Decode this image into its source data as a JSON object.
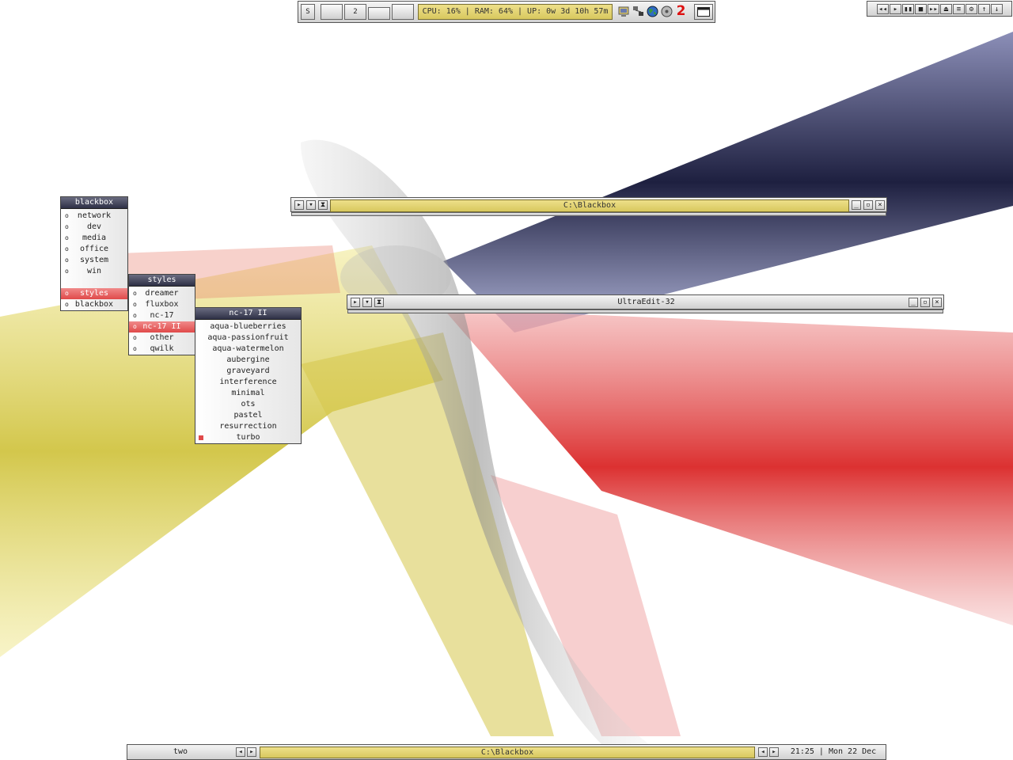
{
  "toolbar": {
    "style_button": "S",
    "workspace_buttons": [
      "",
      "2",
      "",
      ""
    ],
    "status": "CPU: 16% | RAM: 64% | UP: 0w 3d 10h 57m",
    "tray_icons": [
      "system-icon",
      "network-icon",
      "globe-icon",
      "disc-icon",
      "app-2-icon"
    ],
    "tray_icon_label_2": "2"
  },
  "mediabar": {
    "icons": [
      "prev-track-icon",
      "play-icon",
      "pause-icon",
      "stop-icon",
      "next-track-icon",
      "eject-icon",
      "playlist-icon",
      "settings-icon",
      "volume-up-icon",
      "volume-down-icon"
    ]
  },
  "menus": {
    "blackbox": {
      "title": "blackbox",
      "items": [
        "network",
        "dev",
        "media",
        "office",
        "system",
        "win",
        "",
        "styles",
        "blackbox"
      ]
    },
    "styles": {
      "title": "styles",
      "items": [
        "dreamer",
        "fluxbox",
        "nc-17",
        "nc-17 II",
        "other",
        "qwilk"
      ]
    },
    "nc17": {
      "title": "nc-17 II",
      "items": [
        "aqua-blueberries",
        "aqua-passionfruit",
        "aqua-watermelon",
        "aubergine",
        "graveyard",
        "interference",
        "minimal",
        "ots",
        "pastel",
        "resurrection",
        "turbo"
      ]
    }
  },
  "windows": {
    "blackbox": {
      "title": "C:\\Blackbox"
    },
    "ultraedit": {
      "title": "UltraEdit-32"
    }
  },
  "bottombar": {
    "workspace": "two",
    "task": "C:\\Blackbox",
    "clock": "21:25 | Mon 22 Dec"
  },
  "colors": {
    "accent_yellow": "#e2d36e",
    "highlight_red": "#e04a4a",
    "title_dark": "#2e3046"
  }
}
